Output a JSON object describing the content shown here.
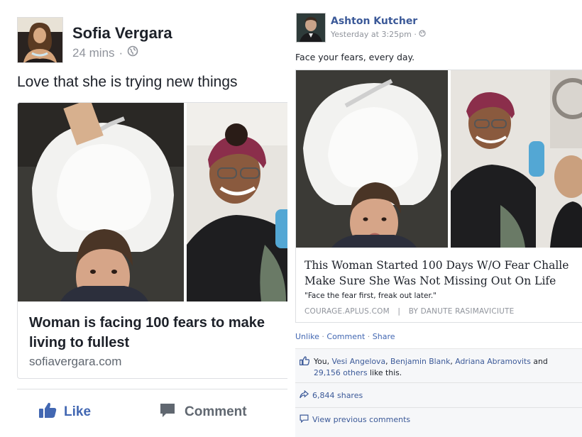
{
  "left_post": {
    "author": "Sofia Vergara",
    "time": "24 mins",
    "separator": "·",
    "message": "Love that she is trying new things",
    "card_title": "Woman is facing 100 fears to make living to fullest",
    "card_domain": "sofiavergara.com",
    "like_label": "Like",
    "comment_label": "Comment",
    "icons": [
      "globe-icon",
      "thumbs-up-icon",
      "comment-icon"
    ],
    "colors": {
      "link_blue": "#4267b2",
      "text": "#1d2129",
      "muted": "#90949c"
    }
  },
  "right_post": {
    "author": "Ashton Kutcher",
    "time": "Yesterday at 3:25pm",
    "separator": "·",
    "message": "Face your fears, every day.",
    "card_title_line1": "This Woman Started 100 Days W/O Fear Challe",
    "card_title_line2": "Make Sure She Was Not Missing Out On Life",
    "card_quote": "\"Face the fear first, freak out later.\"",
    "card_domain": "COURAGE.APLUS.COM",
    "card_byline_sep": "|",
    "card_byline": "BY DANUTE RASIMAVICIUTE",
    "actions": [
      "Unlike",
      "Comment",
      "Share"
    ],
    "likes_prefix": "You,",
    "likers": [
      "Vesi Angelova",
      "Benjamin Blank",
      "Adriana Abramovits"
    ],
    "likes_and": "and",
    "likes_others": "29,156 others",
    "likes_suffix": "like this.",
    "shares": "6,844 shares",
    "view_previous": "View previous comments",
    "icons": [
      "globe-icon",
      "thumbs-up-icon",
      "share-icon",
      "comment-icon"
    ],
    "colors": {
      "link_blue": "#3b5998",
      "panel_bg": "#f6f7f9"
    }
  }
}
